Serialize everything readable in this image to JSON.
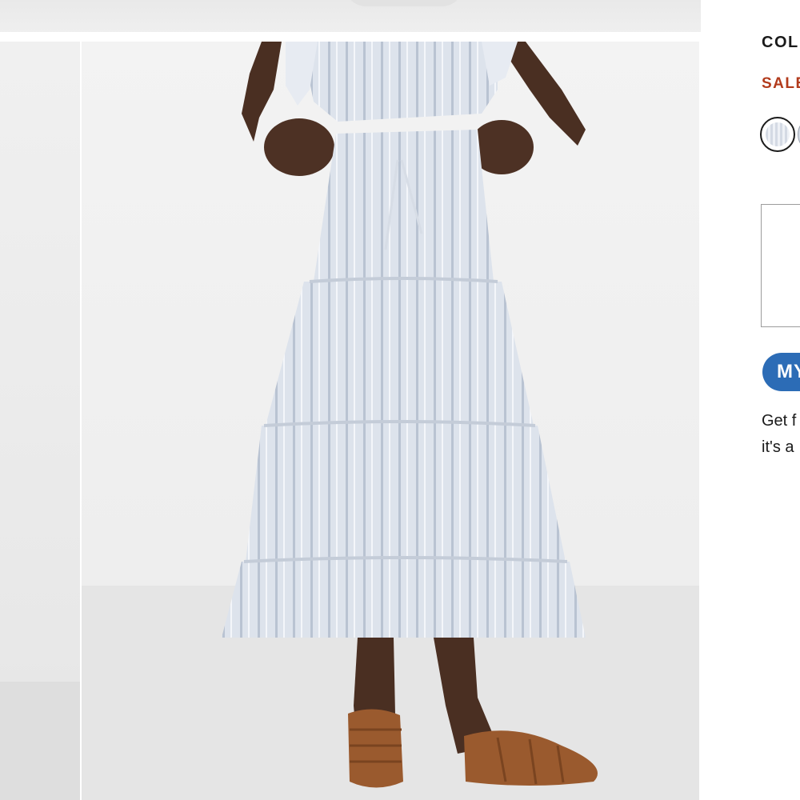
{
  "product_panel": {
    "color_heading": "COL",
    "sale_label": "SALE",
    "swatches": [
      "swatch-selected",
      "swatch-next"
    ],
    "promo_badge": "MY",
    "promo_lines": [
      "Get f",
      "it's a"
    ]
  },
  "gallery": {
    "image_alt": "Model wearing a light blue striped tiered midi skirt with brown woven leather sandals"
  },
  "colors": {
    "sale": "#b23b1c",
    "badge": "#2c6cb6",
    "skirt": "#dbe1ea"
  }
}
